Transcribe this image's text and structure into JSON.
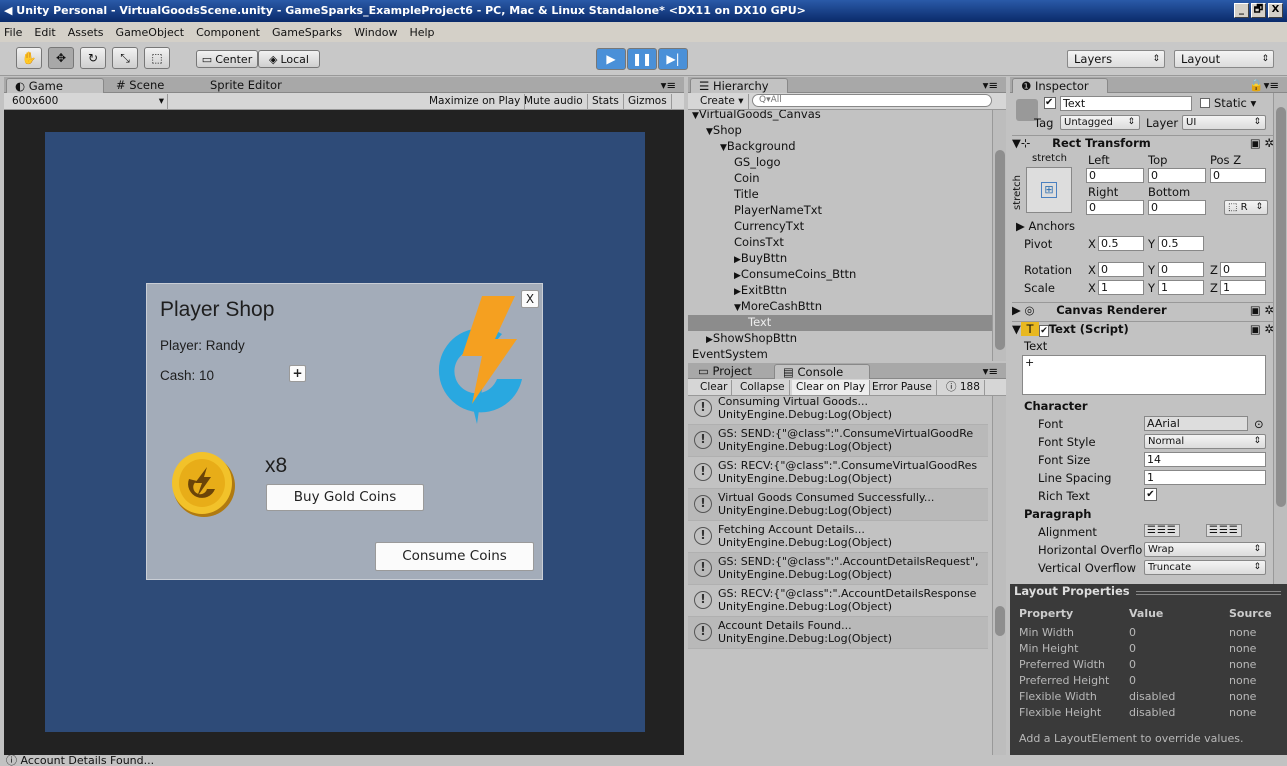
{
  "window": {
    "title": "Unity Personal - VirtualGoodsScene.unity - GameSparks_ExampleProject6 - PC, Mac & Linux Standalone* <DX11 on DX10 GPU>",
    "min": "_",
    "max": "🗗",
    "close": "X"
  },
  "menu": [
    "File",
    "Edit",
    "Assets",
    "GameObject",
    "Component",
    "GameSparks",
    "Window",
    "Help"
  ],
  "toolbar": {
    "center": "Center",
    "local": "Local",
    "layers": "Layers",
    "layout": "Layout"
  },
  "game": {
    "tabs": [
      "Game",
      "Scene",
      "Sprite Editor"
    ],
    "resolution": "600x600",
    "options": [
      "Maximize on Play",
      "Mute audio",
      "Stats",
      "Gizmos"
    ]
  },
  "shop": {
    "title": "Player Shop",
    "player": "Player: Randy",
    "cash": "Cash: 10",
    "plus": "+",
    "close": "X",
    "count": "x8",
    "buy": "Buy Gold Coins",
    "consume": "Consume Coins",
    "colors": {
      "bg": "#2e4b78",
      "panel": "#a3acb9"
    }
  },
  "hierarchy": {
    "tab": "Hierarchy",
    "create": "Create",
    "search": "Q▾All",
    "items": [
      {
        "label": "VirtualGoods_Canvas",
        "arrow": "▼"
      },
      {
        "label": "Shop",
        "arrow": "▼"
      },
      {
        "label": "Background",
        "arrow": "▼"
      },
      {
        "label": "GS_logo",
        "arrow": ""
      },
      {
        "label": "Coin",
        "arrow": ""
      },
      {
        "label": "Title",
        "arrow": ""
      },
      {
        "label": "PlayerNameTxt",
        "arrow": ""
      },
      {
        "label": "CurrencyTxt",
        "arrow": ""
      },
      {
        "label": "CoinsTxt",
        "arrow": ""
      },
      {
        "label": "BuyBttn",
        "arrow": "▶"
      },
      {
        "label": "ConsumeCoins_Bttn",
        "arrow": "▶"
      },
      {
        "label": "ExitBttn",
        "arrow": "▶"
      },
      {
        "label": "MoreCashBttn",
        "arrow": "▼"
      },
      {
        "label": "Text",
        "arrow": ""
      },
      {
        "label": "ShowShopBttn",
        "arrow": "▶"
      },
      {
        "label": "EventSystem",
        "arrow": ""
      }
    ]
  },
  "console": {
    "tabs": [
      "Project",
      "Console"
    ],
    "buttons": [
      "Clear",
      "Collapse",
      "Clear on Play",
      "Error Pause"
    ],
    "count": "188",
    "entries": [
      {
        "l1": "Consuming Virtual Goods...",
        "l2": "UnityEngine.Debug:Log(Object)"
      },
      {
        "l1": "GS: SEND:{\"@class\":\".ConsumeVirtualGoodRe",
        "l2": "UnityEngine.Debug:Log(Object)"
      },
      {
        "l1": "GS: RECV:{\"@class\":\".ConsumeVirtualGoodRes",
        "l2": "UnityEngine.Debug:Log(Object)"
      },
      {
        "l1": "Virtual Goods Consumed Successfully...",
        "l2": "UnityEngine.Debug:Log(Object)"
      },
      {
        "l1": "Fetching Account Details...",
        "l2": "UnityEngine.Debug:Log(Object)"
      },
      {
        "l1": "GS: SEND:{\"@class\":\".AccountDetailsRequest\",",
        "l2": "UnityEngine.Debug:Log(Object)"
      },
      {
        "l1": "GS: RECV:{\"@class\":\".AccountDetailsResponse",
        "l2": "UnityEngine.Debug:Log(Object)"
      },
      {
        "l1": "Account Details Found...",
        "l2": "UnityEngine.Debug:Log(Object)"
      }
    ]
  },
  "inspector": {
    "tab": "Inspector",
    "name": "Text",
    "static": "Static",
    "tag_label": "Tag",
    "tag": "Untagged",
    "layer_label": "Layer",
    "layer": "UI",
    "rect": {
      "title": "Rect Transform",
      "stretch": "stretch",
      "left": "Left",
      "top": "Top",
      "posz": "Pos Z",
      "right": "Right",
      "bottom": "Bottom",
      "v_left": "0",
      "v_top": "0",
      "v_posz": "0",
      "v_right": "0",
      "v_bottom": "0",
      "r": "R",
      "anchors": "Anchors",
      "pivot": "Pivot",
      "pivot_x": "0.5",
      "pivot_y": "0.5",
      "rotation": "Rotation",
      "rot_x": "0",
      "rot_y": "0",
      "rot_z": "0",
      "scale": "Scale",
      "sc_x": "1",
      "sc_y": "1",
      "sc_z": "1",
      "x": "X",
      "y": "Y",
      "z": "Z"
    },
    "canvas_renderer": "Canvas Renderer",
    "text_script": "Text (Script)",
    "text_label": "Text",
    "text_value": "+",
    "character": "Character",
    "font_label": "Font",
    "font": "Arial",
    "font_style_label": "Font Style",
    "font_style": "Normal",
    "font_size_label": "Font Size",
    "font_size": "14",
    "line_spacing_label": "Line Spacing",
    "line_spacing": "1",
    "rich_text_label": "Rich Text",
    "paragraph": "Paragraph",
    "alignment_label": "Alignment",
    "hoverflow_label": "Horizontal Overflo",
    "hoverflow": "Wrap",
    "voverflow_label": "Vertical Overflow",
    "voverflow": "Truncate"
  },
  "layout": {
    "title": "Layout Properties",
    "headers": [
      "Property",
      "Value",
      "Source"
    ],
    "rows": [
      [
        "Min Width",
        "0",
        "none"
      ],
      [
        "Min Height",
        "0",
        "none"
      ],
      [
        "Preferred Width",
        "0",
        "none"
      ],
      [
        "Preferred Height",
        "0",
        "none"
      ],
      [
        "Flexible Width",
        "disabled",
        "none"
      ],
      [
        "Flexible Height",
        "disabled",
        "none"
      ]
    ],
    "footer": "Add a LayoutElement to override values."
  },
  "status": "Account Details Found..."
}
